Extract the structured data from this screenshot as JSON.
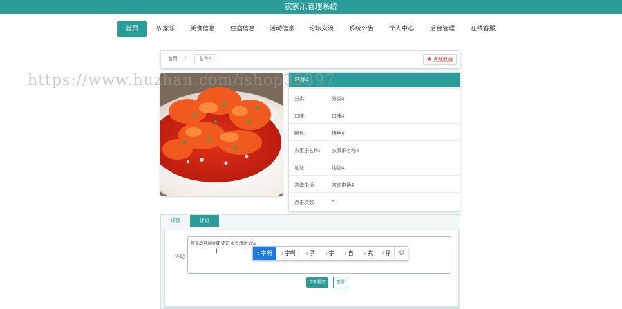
{
  "header": {
    "title": "农家乐管理系统",
    "bg_color": "#2a9d98"
  },
  "nav": {
    "items": [
      {
        "label": "首页",
        "active": true
      },
      {
        "label": "农家乐"
      },
      {
        "label": "美食信息"
      },
      {
        "label": "住宿信息"
      },
      {
        "label": "活动信息"
      },
      {
        "label": "论坛交流"
      },
      {
        "label": "系统公告"
      },
      {
        "label": "个人中心"
      },
      {
        "label": "后台管理"
      },
      {
        "label": "在线客服"
      }
    ]
  },
  "breadcrumb": {
    "home": "首页",
    "separator": "/",
    "current": "名称4"
  },
  "favorite": {
    "label": "点我收藏",
    "icon": "star-icon"
  },
  "info": {
    "title": "名称4",
    "rows": [
      {
        "key": "分类:",
        "value": "分类4"
      },
      {
        "key": "口味:",
        "value": "口味4"
      },
      {
        "key": "特色:",
        "value": "特色4"
      },
      {
        "key": "农家乐名称:",
        "value": "农家乐名称4"
      },
      {
        "key": "地址:",
        "value": "地址4"
      },
      {
        "key": "咨询电话:",
        "value": "咨询电话4"
      },
      {
        "key": "点击次数:",
        "value": "5"
      }
    ]
  },
  "tabs": {
    "detail": "详情",
    "comment": "评论"
  },
  "comment": {
    "label": "评论",
    "value": "登录后可以收藏 评论 报名活动 zi'a",
    "ime_candidates": [
      {
        "n": "1",
        "text": "字啊"
      },
      {
        "n": "2",
        "text": "字啊"
      },
      {
        "n": "3",
        "text": "子"
      },
      {
        "n": "4",
        "text": "字"
      },
      {
        "n": "5",
        "text": "自"
      },
      {
        "n": "6",
        "text": "紫"
      },
      {
        "n": "7",
        "text": "仔"
      }
    ],
    "submit": "立即提交",
    "reset": "重置"
  },
  "watermark": "https://www.huzhan.com/ishop39397"
}
